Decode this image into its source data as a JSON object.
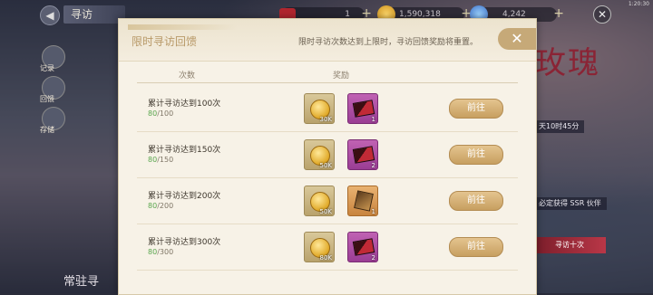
{
  "top": {
    "section_title": "寻访",
    "resources": [
      {
        "icon": "red-envelope-icon",
        "value": "1"
      },
      {
        "icon": "gold-coin-icon",
        "value": "1,590,318"
      },
      {
        "icon": "gem-icon",
        "value": "4,242"
      }
    ],
    "time": "1:20:30"
  },
  "sidebar": [
    {
      "label": "记录"
    },
    {
      "label": "回馈"
    },
    {
      "label": "存储"
    }
  ],
  "background": {
    "banner_text": "玫瑰",
    "pill_time": "天10时45分",
    "pill_ssr": "必定获得 SSR 伙伴",
    "pill_search": "寻访十次",
    "bottom_text": "常驻寻"
  },
  "panel": {
    "title": "限时寻访回馈",
    "note": "限时寻访次数达到上限时，寻访回馈奖励将重置。",
    "close": "✕",
    "col_count": "次数",
    "col_reward": "奖励",
    "rows": [
      {
        "title": "累计寻访达到100次",
        "current": "80",
        "target": "/100",
        "rewards": [
          {
            "type": "coin",
            "qty": "30K"
          },
          {
            "type": "card",
            "qty": "1"
          }
        ],
        "button": "前往"
      },
      {
        "title": "累计寻访达到150次",
        "current": "80",
        "target": "/150",
        "rewards": [
          {
            "type": "coin",
            "qty": "50K"
          },
          {
            "type": "card",
            "qty": "2"
          }
        ],
        "button": "前往"
      },
      {
        "title": "累计寻访达到200次",
        "current": "80",
        "target": "/200",
        "rewards": [
          {
            "type": "coin",
            "qty": "50K"
          },
          {
            "type": "orange",
            "qty": "1"
          }
        ],
        "button": "前往"
      },
      {
        "title": "累计寻访达到300次",
        "current": "80",
        "target": "/300",
        "rewards": [
          {
            "type": "coin",
            "qty": "80K"
          },
          {
            "type": "card",
            "qty": "2"
          }
        ],
        "button": "前往"
      }
    ]
  }
}
